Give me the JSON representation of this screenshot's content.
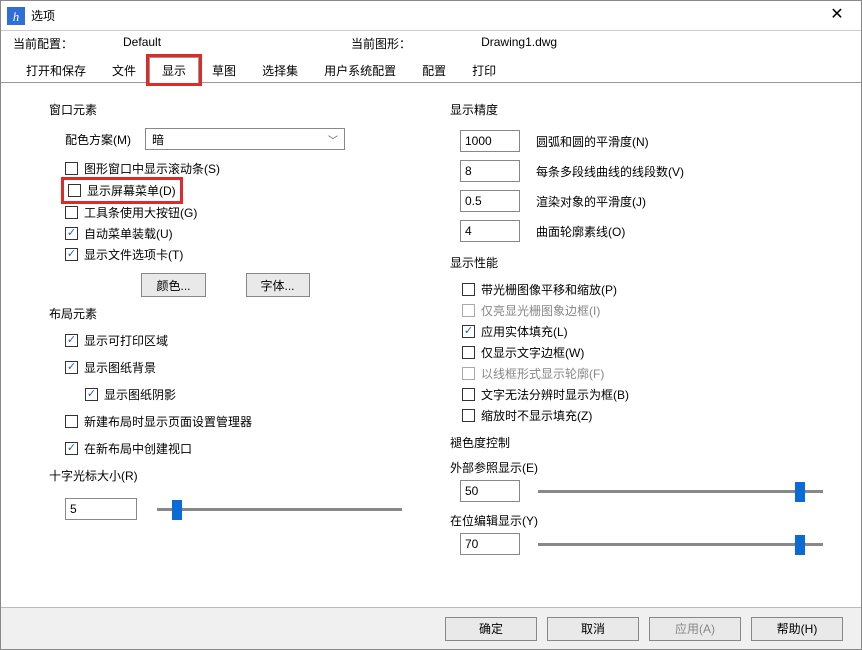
{
  "window": {
    "title": "选项"
  },
  "header": {
    "config_label": "当前配置：",
    "config_value": "Default",
    "drawing_label": "当前图形：",
    "drawing_value": "Drawing1.dwg"
  },
  "tabs": [
    "打开和保存",
    "文件",
    "显示",
    "草图",
    "选择集",
    "用户系统配置",
    "配置",
    "打印"
  ],
  "left": {
    "window_elements": "窗口元素",
    "color_scheme_label": "配色方案(M)",
    "color_scheme_value": "暗",
    "cb_scrollbar": "图形窗口中显示滚动条(S)",
    "cb_screenmenu": "显示屏幕菜单(D)",
    "cb_bigbuttons": "工具条使用大按钮(G)",
    "cb_automenu": "自动菜单装载(U)",
    "cb_filetabs": "显示文件选项卡(T)",
    "btn_color": "颜色...",
    "btn_font": "字体...",
    "layout_elements": "布局元素",
    "cb_printarea": "显示可打印区域",
    "cb_paperbg": "显示图纸背景",
    "cb_papershadow": "显示图纸阴影",
    "cb_pagemgr": "新建布局时显示页面设置管理器",
    "cb_viewport": "在新布局中创建视口",
    "crosshair_label": "十字光标大小(R)",
    "crosshair_value": "5"
  },
  "right": {
    "precision": "显示精度",
    "p1_val": "1000",
    "p1_lbl": "圆弧和圆的平滑度(N)",
    "p2_val": "8",
    "p2_lbl": "每条多段线曲线的线段数(V)",
    "p3_val": "0.5",
    "p3_lbl": "渲染对象的平滑度(J)",
    "p4_val": "4",
    "p4_lbl": "曲面轮廓素线(O)",
    "performance": "显示性能",
    "pf1": "带光栅图像平移和缩放(P)",
    "pf2": "仅亮显光栅图象边框(I)",
    "pf3": "应用实体填充(L)",
    "pf4": "仅显示文字边框(W)",
    "pf5": "以线框形式显示轮廓(F)",
    "pf6": "文字无法分辨时显示为框(B)",
    "pf7": "缩放时不显示填充(Z)",
    "fade": "褪色度控制",
    "fade_xref_lbl": "外部参照显示(E)",
    "fade_xref_val": "50",
    "fade_edit_lbl": "在位编辑显示(Y)",
    "fade_edit_val": "70"
  },
  "footer": {
    "ok": "确定",
    "cancel": "取消",
    "apply": "应用(A)",
    "help": "帮助(H)"
  }
}
